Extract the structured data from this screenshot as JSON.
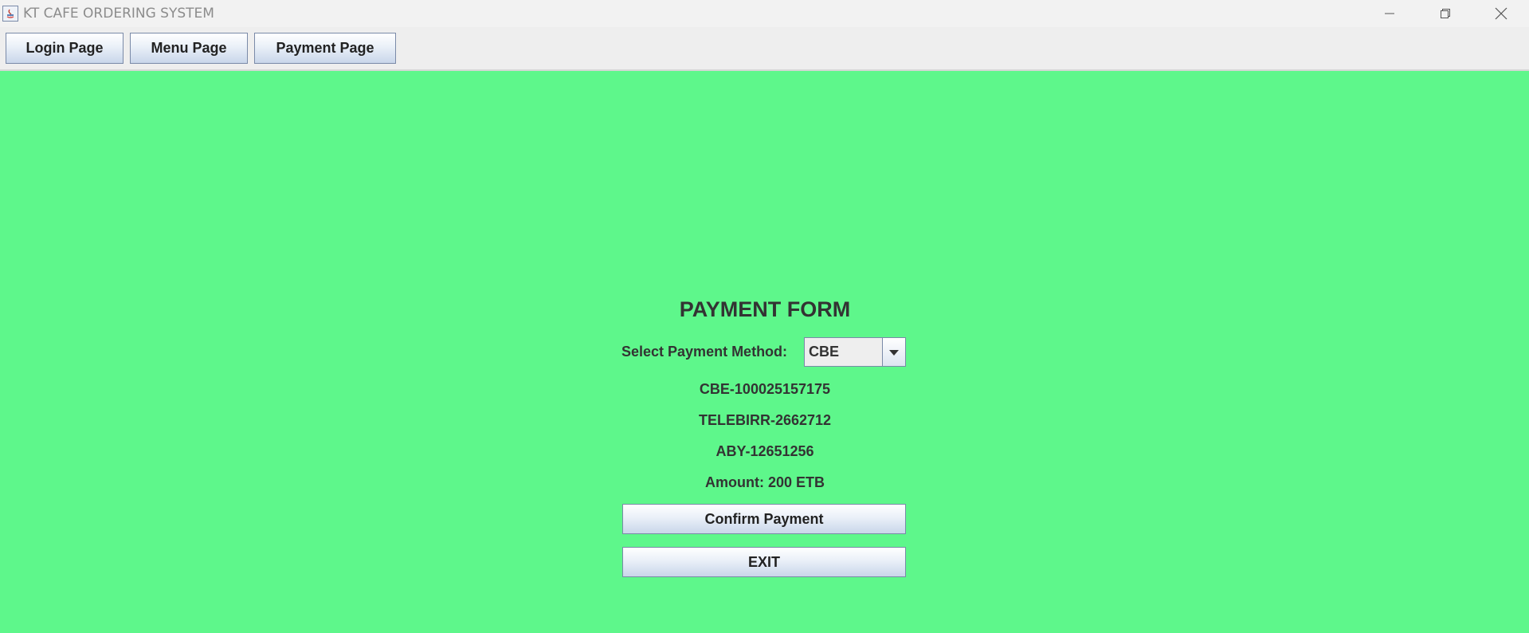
{
  "window": {
    "title": "KT CAFE ORDERING SYSTEM",
    "background_color": "#5ef78b"
  },
  "toolbar": {
    "buttons": [
      {
        "label": "Login Page"
      },
      {
        "label": "Menu Page"
      },
      {
        "label": "Payment Page"
      }
    ]
  },
  "form": {
    "title": "PAYMENT FORM",
    "method_label": "Select Payment Method:",
    "method_selected": "CBE",
    "accounts": {
      "cbe": "CBE-100025157175",
      "telebirr": "TELEBIRR-2662712",
      "aby": "ABY-12651256"
    },
    "amount": "Amount: 200 ETB",
    "confirm_label": "Confirm Payment",
    "exit_label": "EXIT"
  },
  "icons": {
    "app": "java-app-icon",
    "minimize": "minimize-icon",
    "restore": "restore-icon",
    "close": "close-icon",
    "dropdown": "chevron-down-icon"
  }
}
